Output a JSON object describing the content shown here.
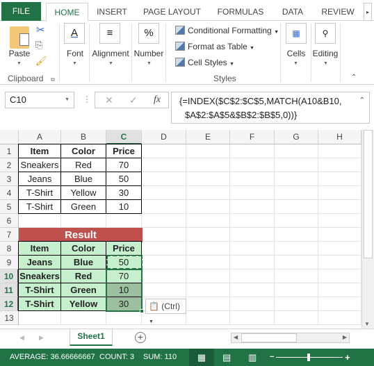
{
  "tabs": [
    "FILE",
    "HOME",
    "INSERT",
    "PAGE LAYOUT",
    "FORMULAS",
    "DATA",
    "REVIEW"
  ],
  "ribbon": {
    "paste": "Paste",
    "clipboard": "Clipboard",
    "font": "Font",
    "alignment": "Alignment",
    "number": "Number",
    "conditional": "Conditional Formatting",
    "format_table": "Format as Table",
    "cell_styles": "Cell Styles",
    "styles": "Styles",
    "cells": "Cells",
    "editing": "Editing"
  },
  "formula_bar": {
    "name_box": "C10",
    "fx": "fx",
    "formula_line1": "{=INDEX($C$2:$C$5,MATCH(A10&B10,",
    "formula_line2": "$A$2:$A$5&$B$2:$B$5,0))}"
  },
  "columns": [
    "A",
    "B",
    "C",
    "D",
    "E",
    "F",
    "G",
    "H"
  ],
  "rows": [
    "1",
    "2",
    "3",
    "4",
    "5",
    "6",
    "7",
    "8",
    "9",
    "10",
    "11",
    "12",
    "13"
  ],
  "source_table": {
    "headers": [
      "Item",
      "Color",
      "Price"
    ],
    "rows": [
      [
        "Sneakers",
        "Red",
        "70"
      ],
      [
        "Jeans",
        "Blue",
        "50"
      ],
      [
        "T-Shirt",
        "Yellow",
        "30"
      ],
      [
        "T-Shirt",
        "Green",
        "10"
      ]
    ]
  },
  "result_table": {
    "title": "Result",
    "headers": [
      "Item",
      "Color",
      "Price"
    ],
    "rows": [
      [
        "Jeans",
        "Blue",
        "50"
      ],
      [
        "Sneakers",
        "Red",
        "70"
      ],
      [
        "T-Shirt",
        "Green",
        "10"
      ],
      [
        "T-Shirt",
        "Yellow",
        "30"
      ]
    ]
  },
  "paste_options": "(Ctrl)",
  "sheet_tab": "Sheet1",
  "status": {
    "average": "AVERAGE: 36.66666667",
    "count": "COUNT: 3",
    "sum": "SUM: 110"
  },
  "colors": {
    "accent": "#217346",
    "result_header": "#c0504d",
    "result_fill": "#c6efce"
  }
}
